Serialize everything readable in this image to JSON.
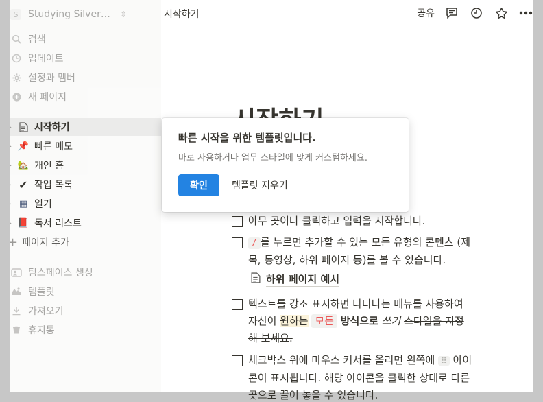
{
  "workspace": {
    "badge": "S",
    "name": "Studying Silver…"
  },
  "sidebar": {
    "top_items": [
      {
        "label": "검색",
        "icon": "search-icon"
      },
      {
        "label": "업데이트",
        "icon": "clock-icon"
      },
      {
        "label": "설정과 멤버",
        "icon": "gear-icon"
      },
      {
        "label": "새 페이지",
        "icon": "plus-circle-icon"
      }
    ],
    "pages": [
      {
        "label": "시작하기",
        "emoji": "📄"
      },
      {
        "label": "빠른 메모",
        "emoji": "📌"
      },
      {
        "label": "개인 홈",
        "emoji": "🏡"
      },
      {
        "label": "작업 목록",
        "emoji": "✔"
      },
      {
        "label": "일기",
        "emoji": "▦"
      },
      {
        "label": "독서 리스트",
        "emoji": "📕"
      }
    ],
    "add_page": "페이지 추가",
    "bottom_items": [
      {
        "label": "팀스페이스 생성",
        "icon": "people-icon"
      },
      {
        "label": "템플릿",
        "icon": "template-icon"
      },
      {
        "label": "가져오기",
        "icon": "download-icon"
      },
      {
        "label": "휴지통",
        "icon": "trash-icon"
      }
    ]
  },
  "topbar": {
    "title": "시작하기",
    "share": "공유"
  },
  "page": {
    "title": "시작하기",
    "todo1": "아무 곳이나 클릭하고 입력을 시작합니다.",
    "todo2_code": "/",
    "todo2_rest": "를 누르면 추가할 수 있는 모든 유형의 콘텐츠 (제목, 동영상, 하위 페이지 등)를 볼 수 있습니다.",
    "subpage": "하위 페이지 예시",
    "todo3_a": "텍스트를 강조 표시하면 나타나는 메뉴를 사용하여",
    "todo3_b": "자신이 ",
    "todo3_hl": "원하는",
    "todo3_chip": "모든",
    "todo3_bold": "방식으로",
    "todo3_italic": "쓰기",
    "todo3_strike1": "스타일을 지정",
    "todo3_strike2": "해 보세요.",
    "todo4_a": "체크박스 위에 마우스 커서를 올리면 왼쪽에 ",
    "todo4_dots": "⠿",
    "todo4_b": " 아이콘이 표시됩니다. 해당 아이콘을 클릭한 상태로 다른 곳으로 끌어 놓을 수 있습니다."
  },
  "modal": {
    "title": "빠른 시작을 위한 템플릿입니다.",
    "desc": "바로 사용하거나 업무 스타일에 맞게 커스텀하세요.",
    "confirm": "확인",
    "remove": "템플릿 지우기"
  },
  "colors": {
    "accent": "#2383e2",
    "code_red": "#eb5757",
    "highlight": "#fbf3db"
  }
}
